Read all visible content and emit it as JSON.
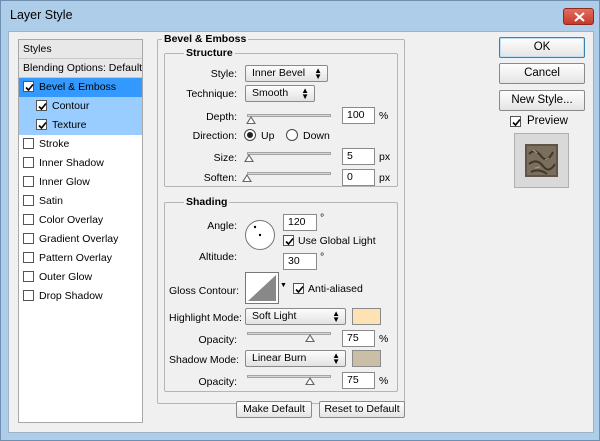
{
  "window": {
    "title": "Layer Style"
  },
  "styles_list": {
    "header": "Styles",
    "blending": "Blending Options: Default",
    "items": [
      {
        "label": "Bevel & Emboss",
        "checked": true
      },
      {
        "label": "Contour",
        "checked": true
      },
      {
        "label": "Texture",
        "checked": true
      },
      {
        "label": "Stroke",
        "checked": false
      },
      {
        "label": "Inner Shadow",
        "checked": false
      },
      {
        "label": "Inner Glow",
        "checked": false
      },
      {
        "label": "Satin",
        "checked": false
      },
      {
        "label": "Color Overlay",
        "checked": false
      },
      {
        "label": "Gradient Overlay",
        "checked": false
      },
      {
        "label": "Pattern Overlay",
        "checked": false
      },
      {
        "label": "Outer Glow",
        "checked": false
      },
      {
        "label": "Drop Shadow",
        "checked": false
      }
    ]
  },
  "bevel": {
    "section_title": "Bevel & Emboss",
    "structure": {
      "title": "Structure",
      "style_label": "Style:",
      "style_value": "Inner Bevel",
      "technique_label": "Technique:",
      "technique_value": "Smooth",
      "depth_label": "Depth:",
      "depth_value": "100",
      "depth_unit": "%",
      "depth_level": 0.05,
      "direction_label": "Direction:",
      "direction_up": "Up",
      "direction_down": "Down",
      "direction_selected": "Up",
      "size_label": "Size:",
      "size_value": "5",
      "size_unit": "px",
      "size_level": 0.02,
      "soften_label": "Soften:",
      "soften_value": "0",
      "soften_unit": "px",
      "soften_level": 0.0
    },
    "shading": {
      "title": "Shading",
      "angle_label": "Angle:",
      "angle_value": "120",
      "angle_unit": "°",
      "global_light_label": "Use Global Light",
      "global_light_checked": true,
      "altitude_label": "Altitude:",
      "altitude_value": "30",
      "altitude_unit": "°",
      "gloss_label": "Gloss Contour:",
      "anti_aliased_label": "Anti-aliased",
      "anti_aliased_checked": true,
      "highlight_mode_label": "Highlight Mode:",
      "highlight_mode_value": "Soft Light",
      "highlight_color": "#ffe2b3",
      "highlight_opacity_label": "Opacity:",
      "highlight_opacity_value": "75",
      "highlight_opacity_unit": "%",
      "highlight_opacity_level": 0.75,
      "shadow_mode_label": "Shadow Mode:",
      "shadow_mode_value": "Linear Burn",
      "shadow_color": "#cbbea6",
      "shadow_opacity_label": "Opacity:",
      "shadow_opacity_value": "75",
      "shadow_opacity_unit": "%",
      "shadow_opacity_level": 0.75
    },
    "make_default": "Make Default",
    "reset_default": "Reset to Default"
  },
  "actions": {
    "ok": "OK",
    "cancel": "Cancel",
    "new_style": "New Style...",
    "preview_label": "Preview",
    "preview_checked": true
  }
}
